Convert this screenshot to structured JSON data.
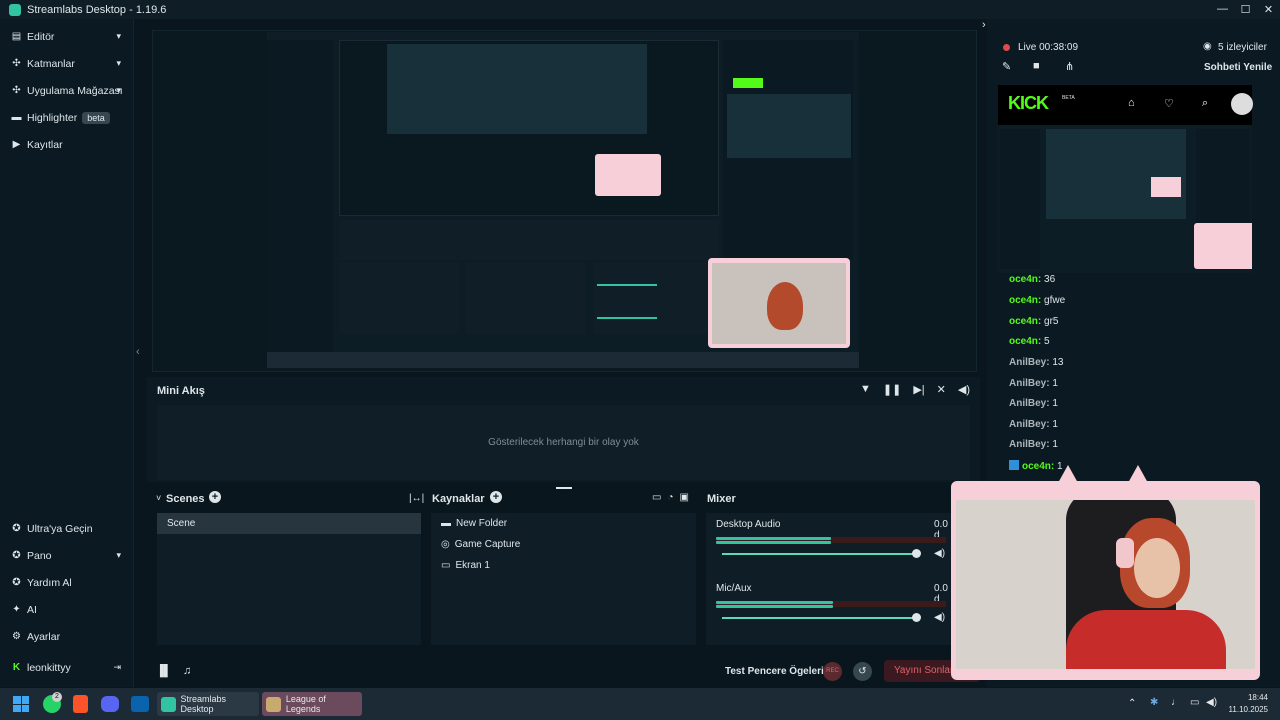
{
  "window": {
    "title": "Streamlabs Desktop - 1.19.6",
    "controls": [
      "—",
      "☐",
      "✕"
    ]
  },
  "sidebar": {
    "top_items": [
      {
        "label": "Editör",
        "icon": "editor-icon",
        "chevron": true
      },
      {
        "label": "Katmanlar",
        "icon": "layers-icon",
        "chevron": true
      },
      {
        "label": "Uygulama Mağazası",
        "icon": "store-icon",
        "chevron": true
      },
      {
        "label": "Highlighter",
        "icon": "highlighter-icon",
        "badge": "beta"
      },
      {
        "label": "Kayıtlar",
        "icon": "play-icon"
      }
    ],
    "bottom_items": [
      {
        "label": "Ultra'ya Geçin",
        "icon": "ultra-icon"
      },
      {
        "label": "Pano",
        "icon": "dashboard-icon",
        "chevron": true
      },
      {
        "label": "Yardım Al",
        "icon": "help-icon"
      },
      {
        "label": "AI",
        "icon": "ai-sparkle-icon"
      },
      {
        "label": "Ayarlar",
        "icon": "settings-icon"
      }
    ],
    "account": {
      "label": "leonkittyy",
      "icon": "kick-k-icon"
    }
  },
  "mini_akis": {
    "title": "Mini Akış",
    "empty_text": "Gösterilecek herhangi bir olay yok"
  },
  "scenes": {
    "title": "Scenes",
    "items": [
      "Scene"
    ]
  },
  "sources": {
    "title": "Kaynaklar",
    "items": [
      {
        "label": "New Folder",
        "icon": "folder-icon"
      },
      {
        "label": "Game Capture",
        "icon": "gamepad-icon"
      },
      {
        "label": "Ekran 1",
        "icon": "monitor-icon"
      }
    ]
  },
  "mixer": {
    "title": "Mixer",
    "channels": [
      {
        "label": "Desktop Audio",
        "db": "0.0 d",
        "level": 0.35,
        "volume": 1.0
      },
      {
        "label": "Mic/Aux",
        "db": "0.0 d",
        "level": 0.36,
        "volume": 1.0
      }
    ]
  },
  "footer": {
    "test_label": "Test Pencere Ögeleri",
    "rec_label": "REC",
    "stop_label": "Yayını Sonland"
  },
  "chat_panel": {
    "live_label": "Live 00:38:09",
    "viewers": "5 izleyiciler",
    "refresh_label": "Sohbeti Yenile",
    "kick_logo": "KICK",
    "kick_beta": "BETA",
    "messages": [
      {
        "user": "oce4n",
        "text": "36",
        "green": true
      },
      {
        "user": "oce4n",
        "text": "gfwe",
        "green": true
      },
      {
        "user": "oce4n",
        "text": "gr5",
        "green": true
      },
      {
        "user": "oce4n",
        "text": "5",
        "green": true
      },
      {
        "user": "AnilBey",
        "text": "13",
        "green": false
      },
      {
        "user": "AnilBey",
        "text": "1",
        "green": false
      },
      {
        "user": "AnilBey",
        "text": "1",
        "green": false
      },
      {
        "user": "AnilBey",
        "text": "1",
        "green": false
      },
      {
        "user": "AnilBey",
        "text": "1",
        "green": false
      },
      {
        "user": "oce4n",
        "text": "1",
        "green": true
      }
    ]
  },
  "taskbar": {
    "apps": [
      {
        "label": "Streamlabs Desktop"
      },
      {
        "label": "League of Legends"
      }
    ],
    "whatsapp_badge": "2",
    "time": "18:44",
    "date": "11.10.2025"
  }
}
